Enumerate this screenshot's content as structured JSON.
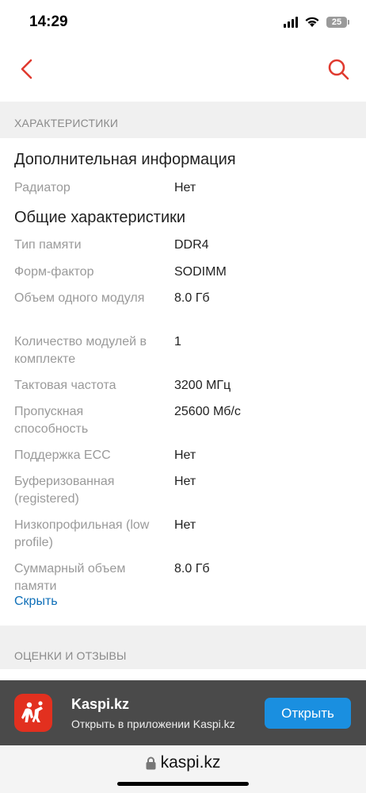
{
  "status_bar": {
    "time": "14:29",
    "battery": "25"
  },
  "icons": {
    "back": "chevron-left-icon",
    "search": "search-icon",
    "lock": "lock-icon"
  },
  "colors": {
    "accent": "#e03a2f",
    "link": "#0f6fb8",
    "open_button": "#1a8fe0"
  },
  "sections": {
    "characteristics_header": "ХАРАКТЕРИСТИКИ",
    "reviews_header": "ОЦЕНКИ И ОТЗЫВЫ"
  },
  "groups": [
    {
      "title": "Дополнительная информация",
      "rows": [
        {
          "label": "Радиатор",
          "value": "Нет"
        }
      ]
    },
    {
      "title": "Общие характеристики",
      "rows": [
        {
          "label": "Тип памяти",
          "value": "DDR4"
        },
        {
          "label": "Форм-фактор",
          "value": "SODIMM"
        },
        {
          "label": "Объем одного модуля",
          "value": "8.0 Гб"
        },
        {
          "label": "Количество модулей в комплекте",
          "value": "1"
        },
        {
          "label": "Тактовая частота",
          "value": "3200 МГц"
        },
        {
          "label": "Пропускная способность",
          "value": "25600 Мб/с"
        },
        {
          "label": "Поддержка ECC",
          "value": "Нет"
        },
        {
          "label": "Буферизованная (registered)",
          "value": "Нет"
        },
        {
          "label": "Низкопрофильная (low profile)",
          "value": "Нет"
        },
        {
          "label": "Суммарный объем памяти",
          "value": "8.0 Гб"
        }
      ]
    }
  ],
  "hide_link": "Скрыть",
  "banner": {
    "title": "Kaspi.kz",
    "subtitle": "Открыть в приложении Kaspi.kz",
    "open_button": "Открыть"
  },
  "browser": {
    "url": "kaspi.kz"
  }
}
